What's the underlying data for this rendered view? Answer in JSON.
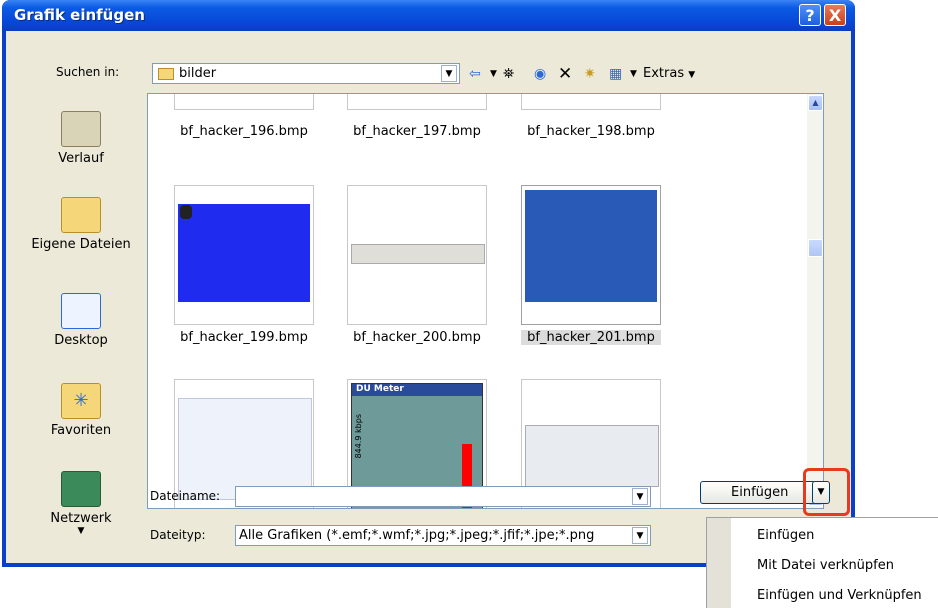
{
  "window": {
    "title": "Grafik einfügen",
    "help_button": "?",
    "close_button": "X"
  },
  "toolbar": {
    "lookin_label": "Suchen in:",
    "lookin_value": "bilder",
    "back_icon": "arrow-left-icon",
    "up_folder_icon": "folder-up-icon",
    "search_web_icon": "search-web-icon",
    "delete_icon": "delete-icon",
    "new_folder_icon": "new-folder-icon",
    "views_icon": "views-icon",
    "extras_label": "Extras"
  },
  "places": [
    {
      "label": "Verlauf",
      "icon": "history-icon"
    },
    {
      "label": "Eigene Dateien",
      "icon": "my-documents-icon"
    },
    {
      "label": "Desktop",
      "icon": "desktop-icon"
    },
    {
      "label": "Favoriten",
      "icon": "favorites-icon"
    },
    {
      "label": "Netzwerk",
      "icon": "network-icon"
    }
  ],
  "files": [
    {
      "name": "bf_hacker_196.bmp"
    },
    {
      "name": "bf_hacker_197.bmp"
    },
    {
      "name": "bf_hacker_198.bmp"
    },
    {
      "name": "bf_hacker_199.bmp"
    },
    {
      "name": "bf_hacker_200.bmp"
    },
    {
      "name": "bf_hacker_201.bmp",
      "selected": true
    },
    {
      "name": ""
    },
    {
      "name": "",
      "thumb_text": "DU Meter",
      "thumb_value": "844.9 kbps"
    },
    {
      "name": ""
    }
  ],
  "filename": {
    "label": "Dateiname:",
    "value": ""
  },
  "filetype": {
    "label": "Dateityp:",
    "value": "Alle Grafiken (*.emf;*.wmf;*.jpg;*.jpeg;*.jfif;*.jpe;*.png"
  },
  "insert_button": {
    "label": "Einfügen"
  },
  "insert_menu": [
    "Einfügen",
    "Mit Datei verknüpfen",
    "Einfügen und Verknüpfen"
  ],
  "colors": {
    "accent": "#0a3fc8",
    "highlight": "#e63b1e"
  }
}
